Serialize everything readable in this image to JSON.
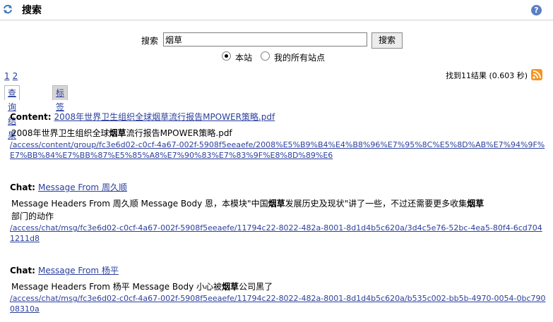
{
  "header": {
    "title": "搜索",
    "refresh_icon": "refresh-icon",
    "help_icon": "help-icon"
  },
  "search": {
    "label": "搜索",
    "value": "烟草",
    "button": "搜索"
  },
  "scope": {
    "options": [
      {
        "label": "本站",
        "selected": true
      },
      {
        "label": "我的所有站点",
        "selected": false
      }
    ]
  },
  "pager": {
    "pages": [
      "1",
      "2"
    ]
  },
  "summary": "找到11结果 (0.603 秒)",
  "tabs": {
    "results": "查询结果",
    "tags": "标签"
  },
  "highlight": "烟草",
  "results": [
    {
      "type_label": "Content:",
      "title": "2008年世界卫生组织全球烟草流行报告MPOWER策略.pdf",
      "snippet_before": "2008年世界卫生组织全球",
      "snippet_after": "流行报告MPOWER策略.pdf",
      "url": "/access/content/group/fc3e6d02-c0cf-4a67-002f-5908f5eeaefe/2008%E5%B9%B4%E4%B8%96%E7%95%8C%E5%8D%AB%E7%94%9F%E7%BB%84%E7%BB%87%E5%85%A8%E7%90%83%E7%83%9F%E8%8D%89%E6"
    },
    {
      "type_label": "Chat:",
      "title": "Message From 周久顺",
      "snippet_before": "Message Headers From 周久顺 Message Body 恩，本模块\"中国",
      "snippet_mid": "发展历史及现状\"讲了一些，不过还需要更多收集",
      "snippet_after": "部门的动作",
      "url": "/access/chat/msg/fc3e6d02-c0cf-4a67-002f-5908f5eeaefe/11794c22-8022-482a-8001-8d1d4b5c620a/3d4c5e76-52bc-4ea5-80f4-6cd7041211d8"
    },
    {
      "type_label": "Chat:",
      "title": "Message From 杨平",
      "snippet_before": "Message Headers From 杨平 Message Body 小心被",
      "snippet_after": "公司黑了",
      "url": "/access/chat/msg/fc3e6d02-c0cf-4a67-002f-5908f5eeaefe/11794c22-8022-482a-8001-8d1d4b5c620a/b535c002-bb5b-4970-0054-0bc79008310a"
    }
  ],
  "colors": {
    "link": "#2a3f9e",
    "rss": "#f7941d",
    "tab_inactive": "#d6d6d6"
  }
}
